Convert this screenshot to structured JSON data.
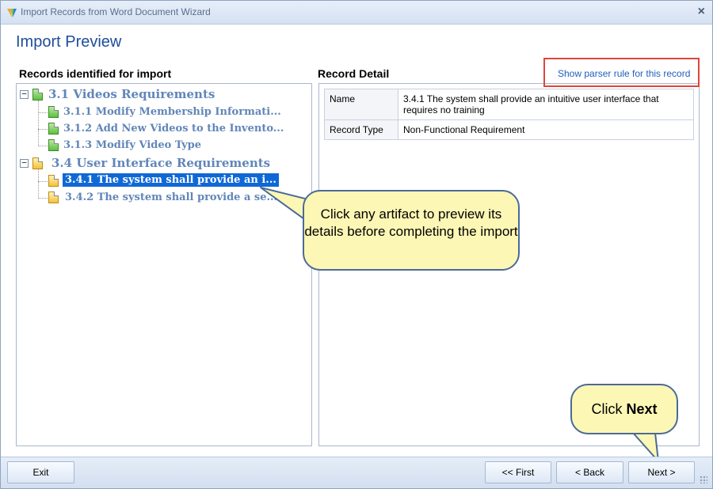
{
  "window": {
    "title": "Import Records from Word Document Wizard",
    "close_glyph": "×"
  },
  "page": {
    "title": "Import Preview"
  },
  "left_panel": {
    "header": "Records identified for import",
    "tree": [
      {
        "label": "3.1 Videos Requirements",
        "expander": "−",
        "icon": "green-document-icon",
        "children": [
          {
            "label": "3.1.1 Modify Membership Informati..."
          },
          {
            "label": "3.1.2 Add New Videos to the Invento..."
          },
          {
            "label": "3.1.3 Modify Video Type"
          }
        ]
      },
      {
        "label": "3.4 User Interface Requirements",
        "expander": "−",
        "icon": "yellow-document-icon",
        "children": [
          {
            "label": "3.4.1 The system shall provide an i...",
            "selected": true
          },
          {
            "label": "3.4.2 The system shall provide a se..."
          }
        ]
      }
    ]
  },
  "right_panel": {
    "header": "Record Detail",
    "parser_link": "Show parser rule for this record",
    "rows": [
      {
        "key": "Name",
        "value": "3.4.1 The system shall provide an intuitive user interface that requires no training"
      },
      {
        "key": "Record Type",
        "value": "Non-Functional Requirement"
      }
    ]
  },
  "callouts": {
    "artifact": "Click any artifact to preview its details before completing the import",
    "next_prefix": "Click ",
    "next_bold": "Next"
  },
  "footer": {
    "exit_label": "Exit",
    "first_label": "<< First",
    "back_label": "< Back",
    "next_label": "Next >"
  },
  "colors": {
    "title_blue": "#1e4d9a",
    "tree_text": "#6186b8",
    "selection": "#0f68d6",
    "callout_fill": "#fdf7b5",
    "highlight_box": "#e0453c"
  }
}
